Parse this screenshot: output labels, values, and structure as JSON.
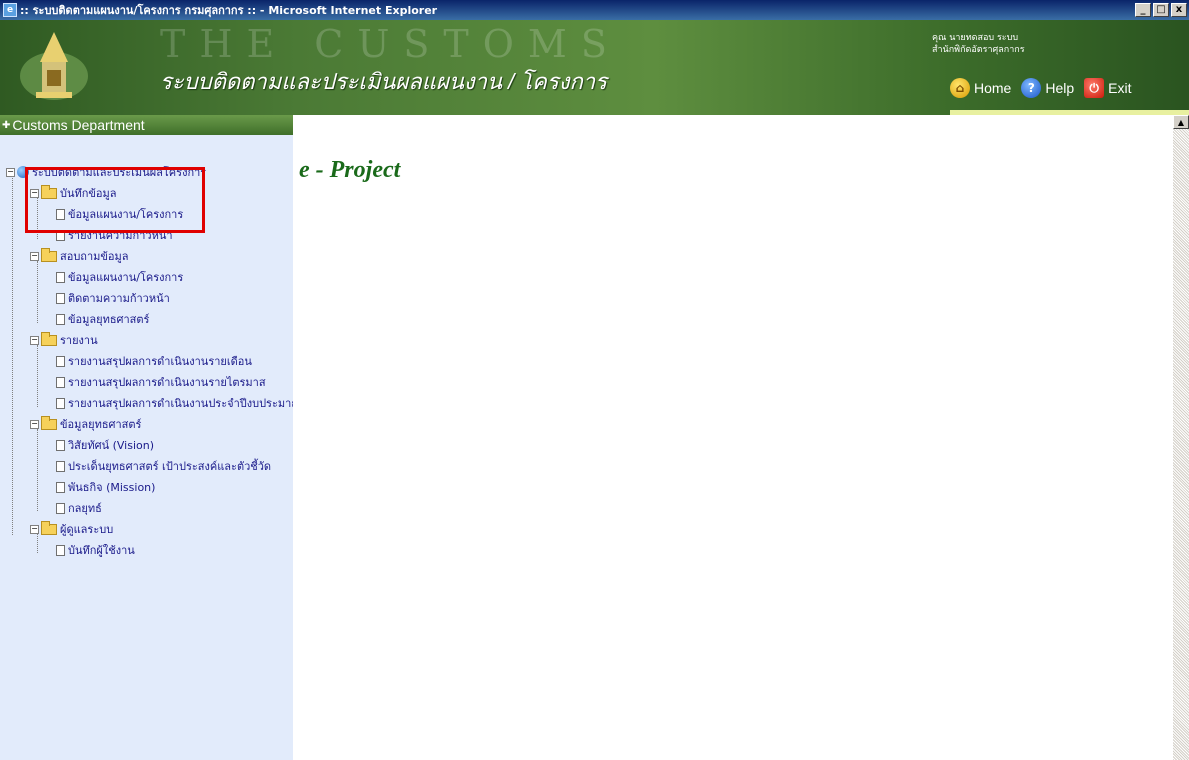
{
  "window": {
    "title": ":: ระบบติดตามแผนงาน/โครงการ กรมศุลกากร :: - Microsoft Internet Explorer",
    "minimize": "_",
    "maximize": "□",
    "close": "x"
  },
  "header": {
    "watermark": "THE CUSTOMS",
    "app_title": "ระบบติดตามและประเมินผลแผนงาน / โครงการ",
    "user_line1": "คุณ นายทดสอบ ระบบ",
    "user_line2": "สำนักพิกัดอัตราศุลกากร",
    "nav": {
      "home": "Home",
      "help": "Help",
      "exit": "Exit"
    }
  },
  "sidebar": {
    "dept_label": "Customs Department",
    "root": "ระบบติดตามและประเมินผลโครงการ",
    "groups": [
      {
        "label": "บันทึกข้อมูล",
        "items": [
          "ข้อมูลแผนงาน/โครงการ",
          "รายงานความก้าวหน้า"
        ]
      },
      {
        "label": "สอบถามข้อมูล",
        "items": [
          "ข้อมูลแผนงาน/โครงการ",
          "ติดตามความก้าวหน้า",
          "ข้อมูลยุทธศาสตร์"
        ]
      },
      {
        "label": "รายงาน",
        "items": [
          "รายงานสรุปผลการดำเนินงานรายเดือน",
          "รายงานสรุปผลการดำเนินงานรายไตรมาส",
          "รายงานสรุปผลการดำเนินงานประจำปีงบประมาณ"
        ]
      },
      {
        "label": "ข้อมูลยุทธศาสตร์",
        "items": [
          "วิสัยทัศน์ (Vision)",
          "ประเด็นยุทธศาสตร์ เป้าประสงค์และตัวชี้วัด",
          "พันธกิจ (Mission)",
          "กลยุทธ์"
        ]
      },
      {
        "label": "ผู้ดูแลระบบ",
        "items": [
          "บันทึกผู้ใช้งาน"
        ]
      }
    ]
  },
  "main": {
    "heading": "e - Project"
  }
}
